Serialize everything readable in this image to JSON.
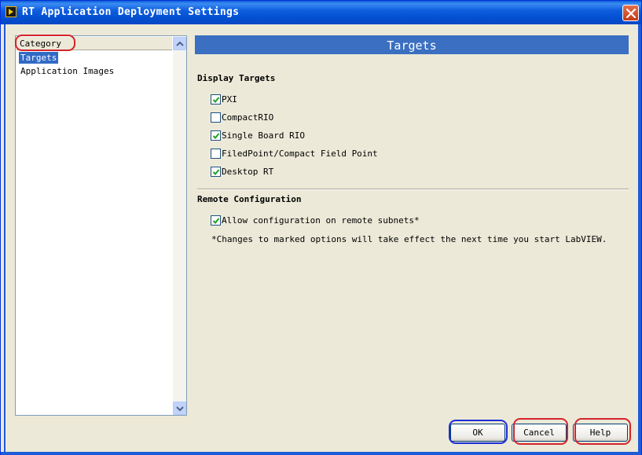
{
  "window": {
    "title": "RT Application Deployment Settings"
  },
  "category": {
    "header": "Category",
    "items": [
      {
        "label": "Targets",
        "selected": true
      },
      {
        "label": "Application Images",
        "selected": false
      }
    ]
  },
  "panel": {
    "banner": "Targets",
    "display_targets": {
      "title": "Display Targets",
      "options": [
        {
          "label": "PXI",
          "checked": true
        },
        {
          "label": "CompactRIO",
          "checked": false
        },
        {
          "label": "Single Board RIO",
          "checked": true
        },
        {
          "label": "FiledPoint/Compact Field Point",
          "checked": false
        },
        {
          "label": "Desktop RT",
          "checked": true
        }
      ]
    },
    "remote": {
      "title": "Remote Configuration",
      "option": {
        "label": "Allow configuration on remote subnets*",
        "checked": true
      },
      "note": "*Changes to marked options will take effect the next time you start LabVIEW."
    }
  },
  "buttons": {
    "ok": "OK",
    "cancel": "Cancel",
    "help": "Help"
  },
  "colors": {
    "selection": "#316AC5",
    "banner": "#3A6FC1",
    "highlight_red": "#D4242B",
    "highlight_blue": "#1E2FD6"
  },
  "icons": [
    "labview-app-icon",
    "close-icon",
    "scroll-up-arrow-icon",
    "scroll-down-arrow-icon",
    "checkmark-icon"
  ]
}
